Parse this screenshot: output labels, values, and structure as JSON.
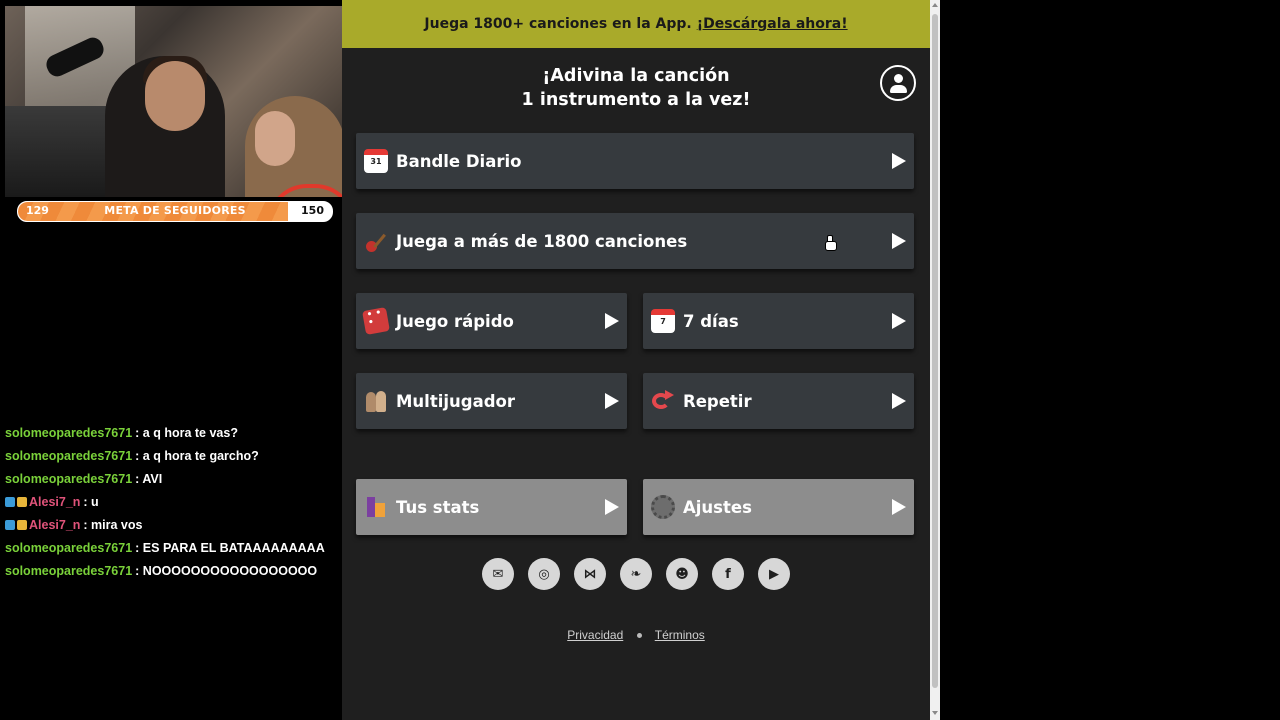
{
  "stream": {
    "goal": {
      "current": "129",
      "title": "META DE SEGUIDORES",
      "max": "150",
      "progress": 0.86
    },
    "chat": [
      {
        "user": "solomeoparedes7671",
        "text": ": a q hora te vas?",
        "color": "#7ad13a",
        "badges": false
      },
      {
        "user": "solomeoparedes7671",
        "text": ": a q hora te garcho?",
        "color": "#7ad13a",
        "badges": false
      },
      {
        "user": "solomeoparedes7671",
        "text": ": AVI",
        "color": "#7ad13a",
        "badges": false
      },
      {
        "user": "Alesi7_n",
        "text": ": u",
        "color": "#e0537a",
        "badges": true
      },
      {
        "user": "Alesi7_n",
        "text": ": mira vos",
        "color": "#e0537a",
        "badges": true
      },
      {
        "user": "solomeoparedes7671",
        "text": ": ES PARA EL BATAAAAAAAAA",
        "color": "#7ad13a",
        "badges": false
      },
      {
        "user": "solomeoparedes7671",
        "text": ": NOOOOOOOOOOOOOOOOO",
        "color": "#7ad13a",
        "badges": false
      }
    ]
  },
  "page": {
    "banner": {
      "text": "Juega 1800+ canciones en la App.",
      "link": "¡Descárgala ahora!",
      "color": "#a9aa2a"
    },
    "title_line1": "¡Adivina la canción",
    "title_line2": "1 instrumento a la vez!",
    "buttons": {
      "daily": "Bandle Diario",
      "daily_icon_text": "31",
      "songs": "Juega a más de 1800 canciones",
      "quick": "Juego rápido",
      "seven": "7 días",
      "seven_icon_text": "7",
      "multi": "Multijugador",
      "repeat": "Repetir",
      "stats": "Tus stats",
      "settings": "Ajustes"
    },
    "social": [
      "mail-icon",
      "instagram-icon",
      "bluesky-icon",
      "twitter-icon",
      "reddit-icon",
      "facebook-icon",
      "youtube-icon"
    ],
    "footer": {
      "privacy": "Privacidad",
      "terms": "Términos"
    }
  }
}
